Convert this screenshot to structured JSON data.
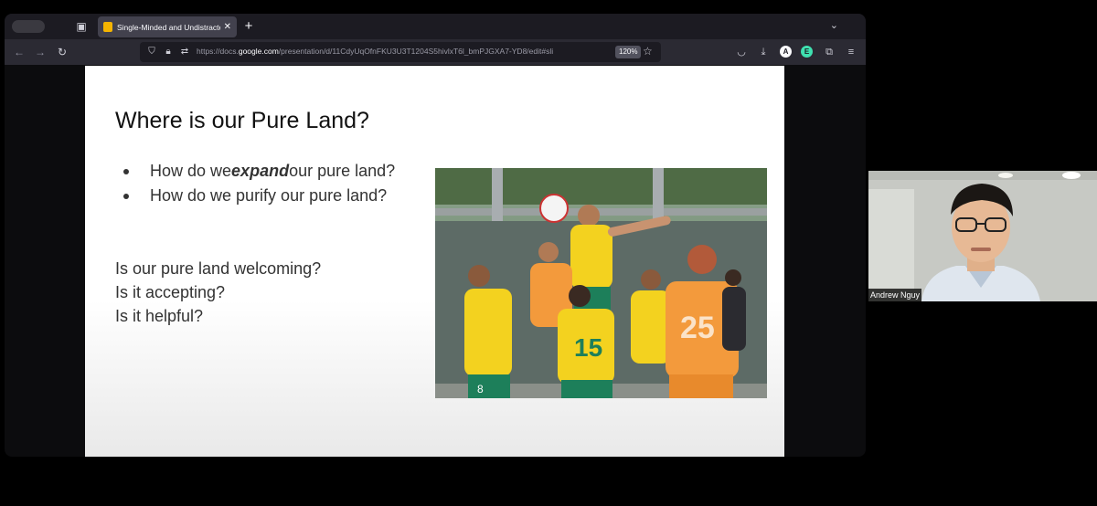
{
  "browser": {
    "tab": {
      "title": "Single-Minded and Undistracte"
    },
    "url": {
      "prefix": "https://docs.",
      "host": "google.com",
      "path": "/presentation/d/11CdyUqOfnFKU3U3T1204S5hivlxT6l_bmPJGXA7-YD8/edit#sli"
    },
    "zoom": "120%",
    "avatar_a": "A",
    "avatar_e": "E"
  },
  "slide": {
    "title": "Where is our Pure Land?",
    "bullets": [
      {
        "before": "How do we ",
        "emph": "expand",
        "after": " our pure land?"
      },
      {
        "text": "How do we purify our pure land?"
      }
    ],
    "questions": [
      "Is our pure land welcoming?",
      "Is it accepting?",
      "Is it helpful?"
    ],
    "photo": {
      "jersey_numbers": [
        "25",
        "15",
        "8"
      ]
    }
  },
  "video": {
    "participant_name": "Andrew Nguy"
  },
  "colors": {
    "tab_bg": "#42414d",
    "toolbar_bg": "#2b2a33",
    "jersey_yellow": "#f3d21f",
    "jersey_orange": "#f39a3c",
    "jersey_green": "#1d7f5a"
  }
}
